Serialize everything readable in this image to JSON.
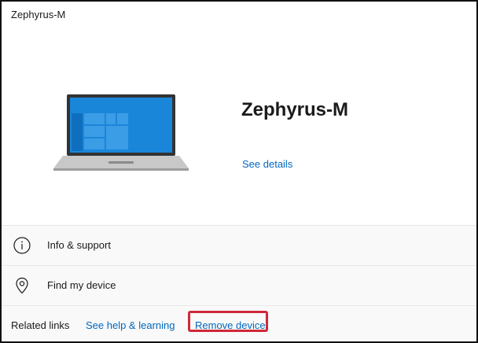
{
  "window": {
    "title": "Zephyrus-M"
  },
  "device": {
    "name": "Zephyrus-M",
    "see_details_label": "See details"
  },
  "settings_items": [
    {
      "label": "Info & support",
      "icon": "info-icon"
    },
    {
      "label": "Find my device",
      "icon": "location-pin-icon"
    }
  ],
  "related_links": {
    "caption": "Related links",
    "help_label": "See help & learning",
    "remove_label": "Remove device"
  },
  "colors": {
    "link": "#0067c0",
    "highlight": "#d0293a",
    "laptop_screen": "#1a86d9"
  }
}
